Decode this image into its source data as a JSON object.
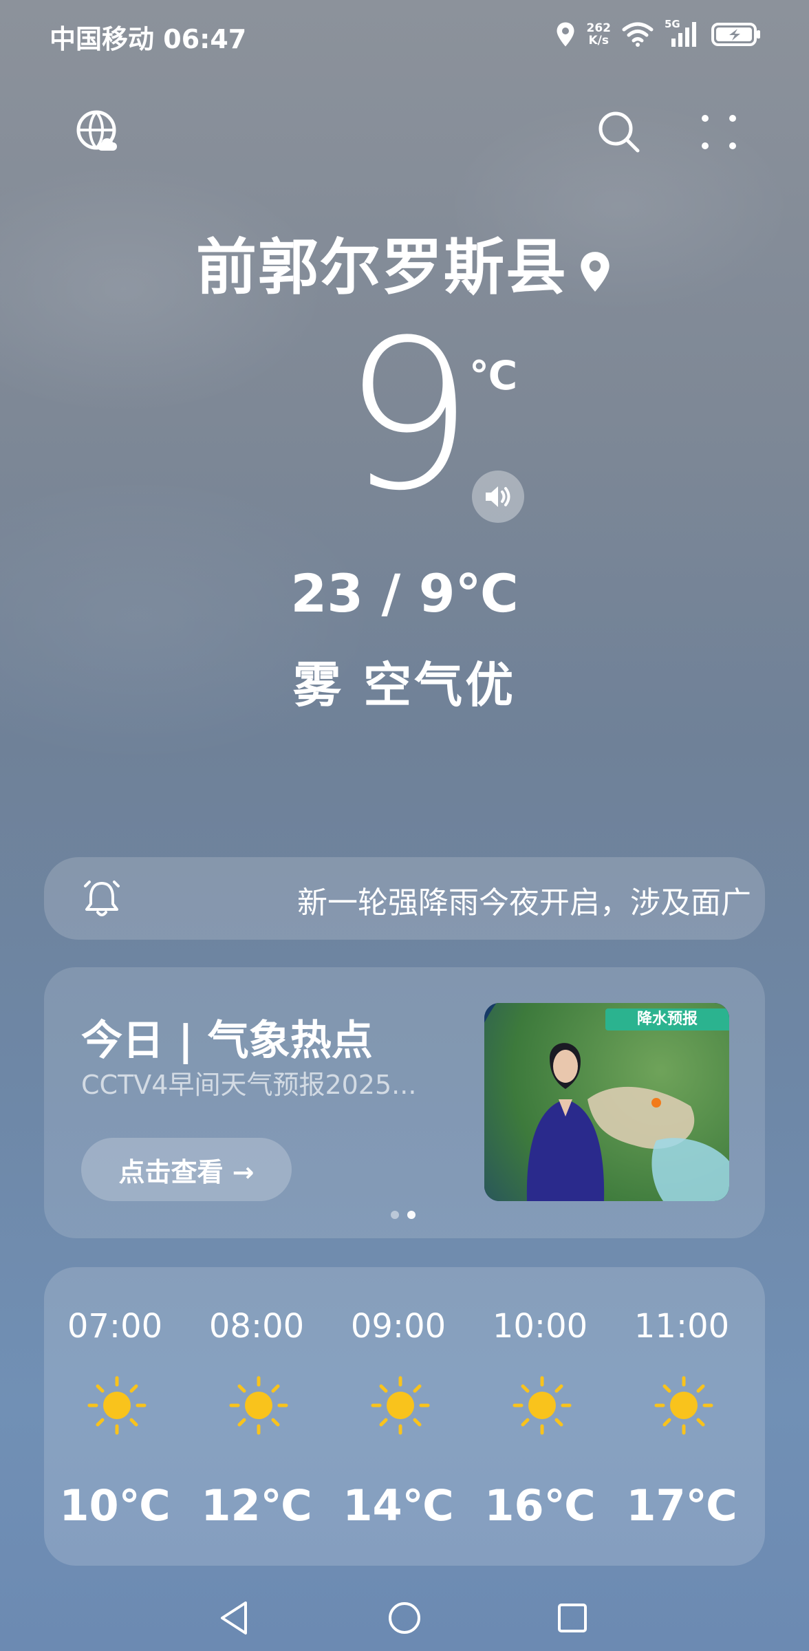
{
  "status_bar": {
    "carrier": "中国移动",
    "time": "06:47",
    "speed_value": "262",
    "speed_unit": "K/s",
    "network": "5G"
  },
  "top_bar": {
    "left_icon": "globe-cloud-icon",
    "search_icon": "search-icon",
    "menu_icon": "grid-dots-icon"
  },
  "current": {
    "city": "前郭尔罗斯县",
    "temperature": "9",
    "unit": "℃",
    "range": "23 / 9℃",
    "condition": "雾 空气优"
  },
  "alert": {
    "text": "新一轮强降雨今夜开启，涉及面广"
  },
  "hot_topic": {
    "title": "今日 | 气象热点",
    "subtitle": "CCTV4早间天气预报2025...",
    "button_label": "点击查看 →",
    "thumbnail_badge": "降水预报",
    "page_count": 2,
    "active_page": 2
  },
  "hourly": [
    {
      "time": "07:00",
      "icon": "sun-icon",
      "temp": "10℃"
    },
    {
      "time": "08:00",
      "icon": "sun-icon",
      "temp": "12℃"
    },
    {
      "time": "09:00",
      "icon": "sun-icon",
      "temp": "14℃"
    },
    {
      "time": "10:00",
      "icon": "sun-icon",
      "temp": "16℃"
    },
    {
      "time": "11:00",
      "icon": "sun-icon",
      "temp": "17℃"
    }
  ],
  "colors": {
    "sun": "#f9c31c",
    "badge": "#2bb38f"
  }
}
